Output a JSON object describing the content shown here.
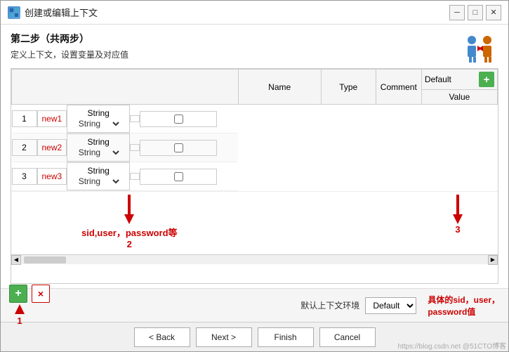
{
  "window": {
    "title": "创建或编辑上下文",
    "icon": "context-icon"
  },
  "header": {
    "step": "第二步（共两步）",
    "desc": "定义上下文，设置变量及对应值"
  },
  "table": {
    "columns": {
      "num": "",
      "name": "Name",
      "type": "Type",
      "comment": "Comment",
      "default": "Default",
      "value": "Value"
    },
    "add_col_btn": "+",
    "rows": [
      {
        "num": "1",
        "name": "new1",
        "type": "String",
        "comment": "",
        "checked": false
      },
      {
        "num": "2",
        "name": "new2",
        "type": "String",
        "comment": "",
        "checked": false
      },
      {
        "num": "3",
        "name": "new3",
        "type": "String",
        "comment": "",
        "checked": false
      }
    ]
  },
  "annotations": {
    "anno1_text": "sid,user，password等",
    "anno1_num": "2",
    "anno2_num": "3"
  },
  "bottom": {
    "add_btn": "+",
    "remove_btn": "×",
    "env_label": "默认上下文环境",
    "env_value": "Default",
    "env_desc": "具体的sid，user，\npassword值",
    "anno1_num": "1"
  },
  "footer": {
    "back": "< Back",
    "next": "Next >",
    "finish": "Finish",
    "cancel": "Cancel"
  },
  "watermark": "https://blog.csdn.net @51CTO博客"
}
